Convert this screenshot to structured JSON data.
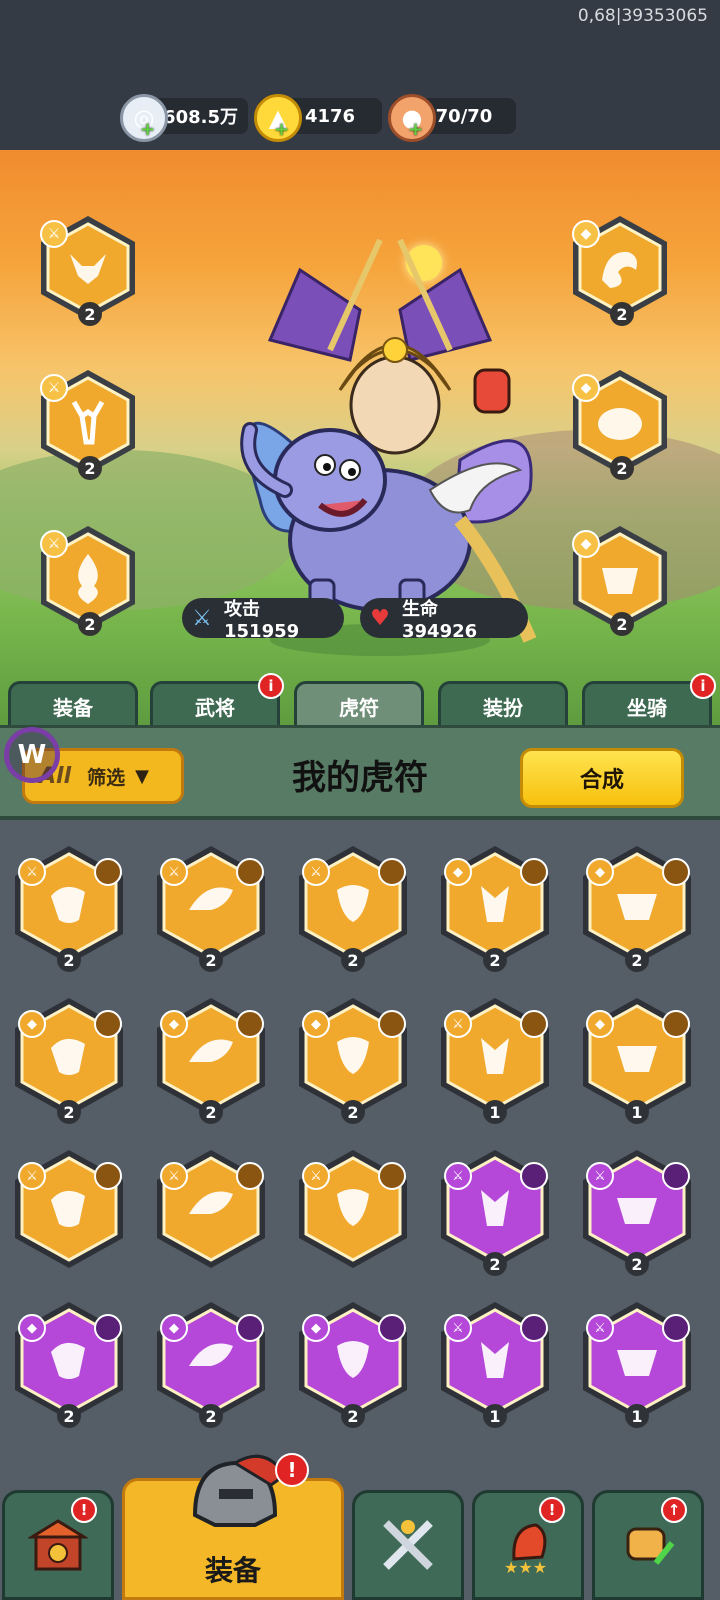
{
  "debug": {
    "text": "0,68|39353065"
  },
  "resources": {
    "silver": {
      "value": "2608.5万",
      "icon": "silver-coin-icon"
    },
    "gold": {
      "value": "4176",
      "icon": "gold-ingot-icon"
    },
    "stamina": {
      "value": "70/70",
      "icon": "meat-icon"
    }
  },
  "hero": {
    "attack_label": "攻击 151959",
    "hp_label": "生命 394926"
  },
  "equipped_slots": [
    {
      "side": "left",
      "level": "2",
      "tier": "gold",
      "emblem": "fox-emblem-icon",
      "type": "sword-icon"
    },
    {
      "side": "left",
      "level": "2",
      "tier": "gold",
      "emblem": "deer-emblem-icon",
      "type": "sword-icon"
    },
    {
      "side": "left",
      "level": "2",
      "tier": "gold",
      "emblem": "flame-emblem-icon",
      "type": "sword-icon"
    },
    {
      "side": "right",
      "level": "2",
      "tier": "gold",
      "emblem": "dragon-emblem-icon",
      "type": "shield-icon"
    },
    {
      "side": "right",
      "level": "2",
      "tier": "gold",
      "emblem": "boar-emblem-icon",
      "type": "shield-icon"
    },
    {
      "side": "right",
      "level": "2",
      "tier": "gold",
      "emblem": "tiger-emblem-icon",
      "type": "shield-icon"
    }
  ],
  "tabs": [
    {
      "label": "装备",
      "badge": false
    },
    {
      "label": "武将",
      "badge": true
    },
    {
      "label": "虎符",
      "badge": false,
      "active": true
    },
    {
      "label": "装扮",
      "badge": false
    },
    {
      "label": "坐骑",
      "badge": true
    }
  ],
  "panel": {
    "filter_all": "All",
    "filter_label": "筛选",
    "title": "我的虎符",
    "merge_button": "合成"
  },
  "inventory": [
    {
      "level": "2",
      "tier": "gold",
      "type": "sword"
    },
    {
      "level": "2",
      "tier": "gold",
      "type": "sword"
    },
    {
      "level": "2",
      "tier": "gold",
      "type": "sword"
    },
    {
      "level": "2",
      "tier": "gold",
      "type": "shield"
    },
    {
      "level": "2",
      "tier": "gold",
      "type": "shield"
    },
    {
      "level": "2",
      "tier": "gold",
      "type": "shield"
    },
    {
      "level": "2",
      "tier": "gold",
      "type": "shield"
    },
    {
      "level": "2",
      "tier": "gold",
      "type": "shield"
    },
    {
      "level": "1",
      "tier": "gold",
      "type": "sword"
    },
    {
      "level": "1",
      "tier": "gold",
      "type": "shield"
    },
    {
      "level": "",
      "tier": "gold",
      "type": "sword"
    },
    {
      "level": "",
      "tier": "gold",
      "type": "sword"
    },
    {
      "level": "",
      "tier": "gold",
      "type": "sword"
    },
    {
      "level": "2",
      "tier": "purple",
      "type": "sword"
    },
    {
      "level": "2",
      "tier": "purple",
      "type": "sword"
    },
    {
      "level": "2",
      "tier": "purple",
      "type": "shield"
    },
    {
      "level": "2",
      "tier": "purple",
      "type": "shield"
    },
    {
      "level": "2",
      "tier": "purple",
      "type": "shield"
    },
    {
      "level": "1",
      "tier": "purple",
      "type": "sword"
    },
    {
      "level": "1",
      "tier": "purple",
      "type": "sword"
    }
  ],
  "bottom_nav": [
    {
      "label": "",
      "icon": "gate-icon",
      "badge": "!",
      "active": false
    },
    {
      "label": "装备",
      "icon": "helmet-icon",
      "badge": "!",
      "active": true
    },
    {
      "label": "",
      "icon": "crossed-swords-icon",
      "badge": "",
      "active": false
    },
    {
      "label": "",
      "icon": "hero-stars-icon",
      "badge": "!",
      "active": false
    },
    {
      "label": "",
      "icon": "fist-upgrade-icon",
      "badge": "↑",
      "active": false
    }
  ],
  "colors": {
    "gold_tier": "#f0a92c",
    "purple_tier": "#b548d8",
    "accent_yellow": "#f7c10e"
  }
}
